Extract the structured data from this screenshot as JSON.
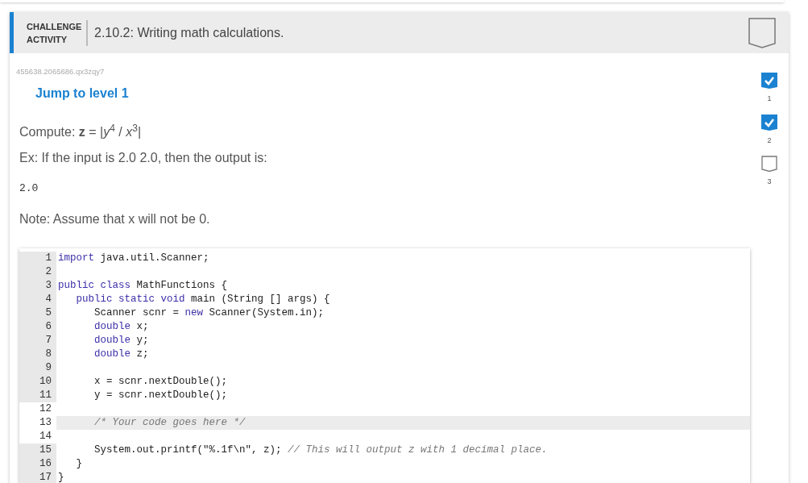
{
  "header": {
    "label": "CHALLENGE ACTIVITY",
    "title": "2.10.2: Writing math calculations."
  },
  "activity_id": "455638.2065686.qx3zqy7",
  "jump_link": "Jump to level 1",
  "levels": [
    {
      "label": "1",
      "completed": true
    },
    {
      "label": "2",
      "completed": true
    },
    {
      "label": "3",
      "completed": false
    }
  ],
  "prompt": "Compute: **z** = |*y*$^{4}$ / *x*$^{3}$|",
  "example": "Ex: If the input is 2.0 2.0, then the output is:",
  "example_output": "2.0",
  "note": "Note: Assume that x will not be 0.",
  "code_lines": [
    {
      "number": "1",
      "editable": false,
      "active": false,
      "segments": [
        {
          "text": "import",
          "kind": "keyword"
        },
        {
          "text": " java.util.Scanner;",
          "kind": "plain"
        }
      ]
    },
    {
      "number": "2",
      "editable": false,
      "active": false
    },
    {
      "number": "3",
      "editable": false,
      "active": false,
      "segments": [
        {
          "text": "public class",
          "kind": "keyword"
        },
        {
          "text": " MathFunctions {",
          "kind": "plain"
        }
      ]
    },
    {
      "number": "4",
      "editable": false,
      "active": false,
      "segments": [
        {
          "text": "   public static void",
          "kind": "keyword"
        },
        {
          "text": " main (String [] args) {",
          "kind": "plain"
        }
      ]
    },
    {
      "number": "5",
      "editable": false,
      "active": false,
      "segments": [
        {
          "text": "      Scanner scnr = ",
          "kind": "plain"
        },
        {
          "text": "new",
          "kind": "keyword"
        },
        {
          "text": " Scanner(System.in);",
          "kind": "plain"
        }
      ]
    },
    {
      "number": "6",
      "editable": false,
      "active": false,
      "segments": [
        {
          "text": "      double",
          "kind": "keyword"
        },
        {
          "text": " x;",
          "kind": "plain"
        }
      ]
    },
    {
      "number": "7",
      "editable": false,
      "active": false,
      "segments": [
        {
          "text": "      double",
          "kind": "keyword"
        },
        {
          "text": " y;",
          "kind": "plain"
        }
      ]
    },
    {
      "number": "8",
      "editable": false,
      "active": false,
      "segments": [
        {
          "text": "      double",
          "kind": "keyword"
        },
        {
          "text": " z;",
          "kind": "plain"
        }
      ]
    },
    {
      "number": "9",
      "editable": false,
      "active": false
    },
    {
      "number": "10",
      "editable": false,
      "active": false,
      "segments": [
        {
          "text": "      x = scnr.nextDouble();",
          "kind": "plain"
        }
      ]
    },
    {
      "number": "11",
      "editable": false,
      "active": false,
      "segments": [
        {
          "text": "      y = scnr.nextDouble();",
          "kind": "plain"
        }
      ]
    },
    {
      "number": "12",
      "editable": true,
      "active": false
    },
    {
      "number": "13",
      "editable": true,
      "active": true,
      "segments": [
        {
          "text": "      /* Your code goes here */",
          "kind": "comment"
        }
      ]
    },
    {
      "number": "14",
      "editable": true,
      "active": false
    },
    {
      "number": "15",
      "editable": false,
      "active": false,
      "segments": [
        {
          "text": "      System.out.printf(\"%.1f\\n\", z); ",
          "kind": "plain"
        },
        {
          "text": "// This will output z with 1 decimal place.",
          "kind": "comment"
        }
      ]
    },
    {
      "number": "16",
      "editable": false,
      "active": false,
      "segments": [
        {
          "text": "   }",
          "kind": "plain"
        }
      ]
    },
    {
      "number": "17",
      "editable": false,
      "active": false,
      "segments": [
        {
          "text": "}",
          "kind": "plain"
        }
      ]
    }
  ]
}
